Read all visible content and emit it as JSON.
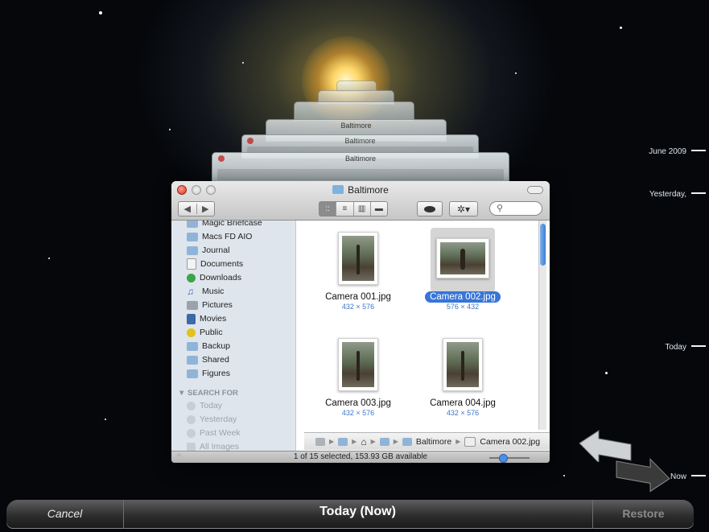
{
  "window": {
    "title": "Baltimore",
    "stack_titles": [
      "Baltimore",
      "Baltimore",
      "Baltimore",
      "Baltimore"
    ]
  },
  "toolbar": {
    "back": "◀",
    "forward": "▶",
    "view_icon": "::",
    "view_list": "≡",
    "view_columns": "▥",
    "view_coverflow": "▬",
    "quicklook_icon": "eye-icon",
    "action_icon": "gear-icon",
    "search_icon": "search-icon"
  },
  "sidebar": {
    "items": [
      {
        "label": "Magic Briefcase",
        "icon": "folder-icon"
      },
      {
        "label": "Macs FD AIO",
        "icon": "folder-icon"
      },
      {
        "label": "Journal",
        "icon": "folder-icon"
      },
      {
        "label": "Documents",
        "icon": "document-icon"
      },
      {
        "label": "Downloads",
        "icon": "downloads-icon"
      },
      {
        "label": "Music",
        "icon": "music-icon"
      },
      {
        "label": "Pictures",
        "icon": "pictures-icon"
      },
      {
        "label": "Movies",
        "icon": "movies-icon"
      },
      {
        "label": "Public",
        "icon": "public-icon"
      },
      {
        "label": "Backup",
        "icon": "folder-icon"
      },
      {
        "label": "Shared",
        "icon": "folder-icon"
      },
      {
        "label": "Figures",
        "icon": "folder-icon"
      }
    ],
    "search_header": "▼ SEARCH FOR",
    "search_items": [
      "Today",
      "Yesterday",
      "Past Week",
      "All Images"
    ]
  },
  "files": [
    {
      "name": "Camera 001.jpg",
      "size": "432 × 576",
      "selected": false
    },
    {
      "name": "Camera 002.jpg",
      "size": "576 × 432",
      "selected": true
    },
    {
      "name": "Camera 003.jpg",
      "size": "432 × 576",
      "selected": false
    },
    {
      "name": "Camera 004.jpg",
      "size": "432 × 576",
      "selected": false
    }
  ],
  "pathbar": {
    "folder": "Baltimore",
    "file": "Camera 002.jpg"
  },
  "status": "1 of 15 selected, 153.93 GB available",
  "timeline": {
    "labels": [
      "June 2009",
      "Yesterday,",
      "Today",
      "Now"
    ]
  },
  "bottombar": {
    "cancel": "Cancel",
    "title": "Today (Now)",
    "restore": "Restore"
  }
}
